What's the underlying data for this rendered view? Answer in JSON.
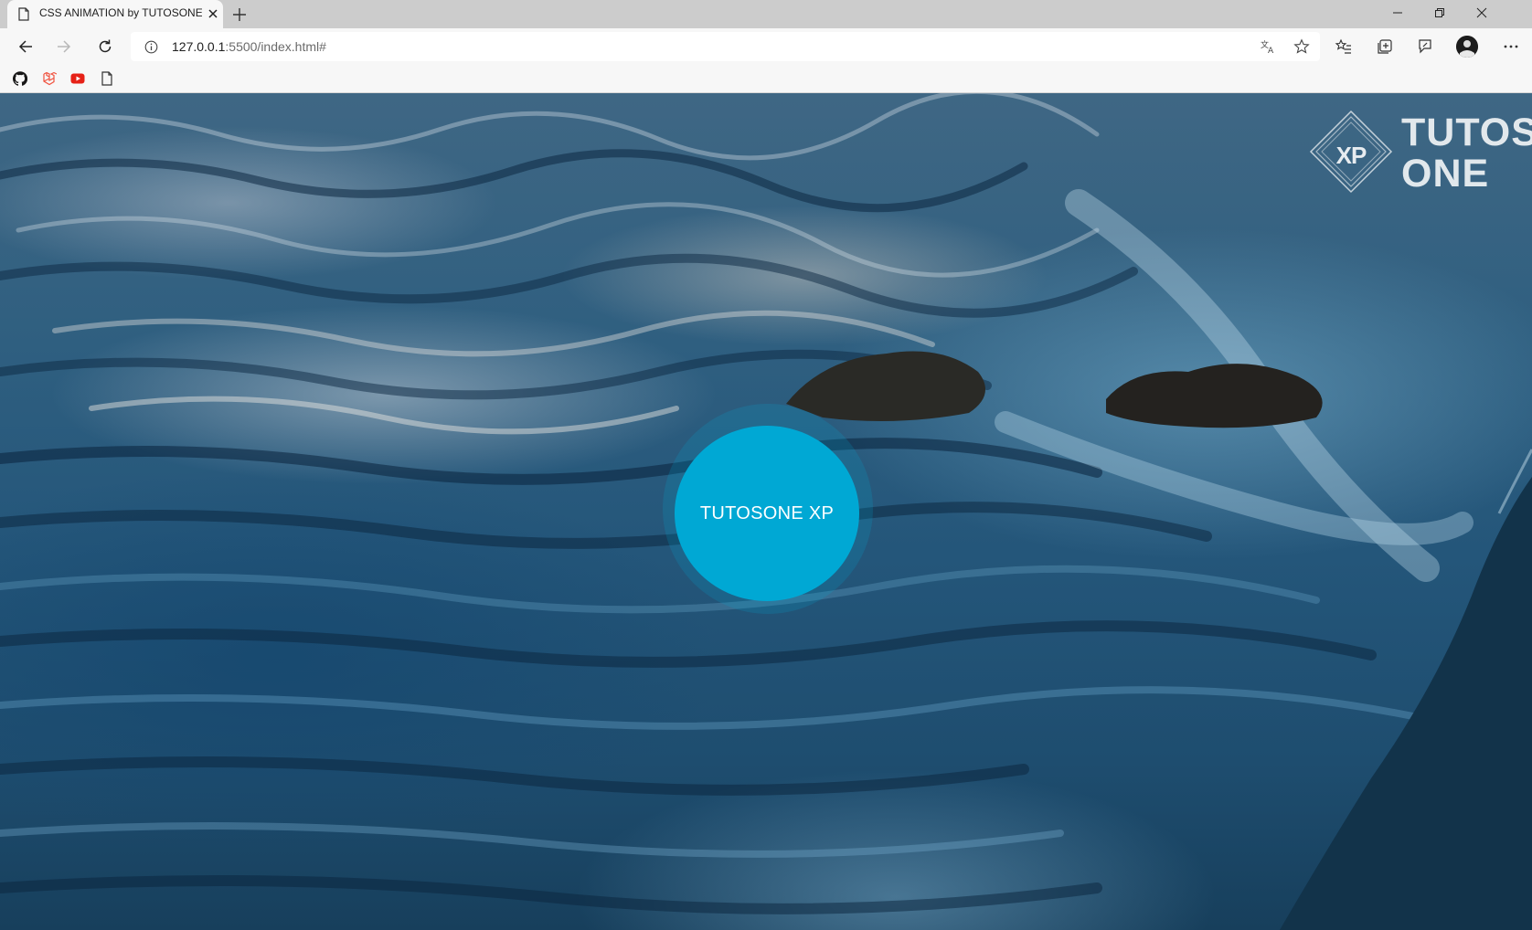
{
  "browser": {
    "tab_title": "CSS ANIMATION by TUTOSONE XP",
    "url_host": "127.0.0.1",
    "url_rest": ":5500/index.html#",
    "favorites": [
      "github-icon",
      "laravel-icon",
      "youtube-icon",
      "page-icon"
    ],
    "toolbar_icons": [
      "translate-icon",
      "star-icon",
      "favorites-icon",
      "collections-icon",
      "feedback-icon",
      "profile-icon",
      "more-icon"
    ]
  },
  "page": {
    "logo": {
      "badge": "XP",
      "line1": "TUTOS",
      "line2": "ONE"
    },
    "button_label": "TUTOSONE XP",
    "button_color": "#00a8d4"
  }
}
